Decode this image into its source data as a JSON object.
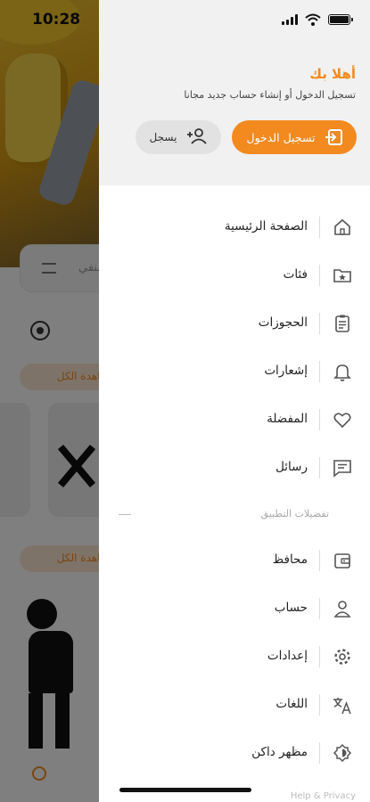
{
  "status_bar": {
    "time": "10:28"
  },
  "background": {
    "search_placeholder": "منفي",
    "view_all_1": "مشاهدة الكل",
    "view_all_2": "مشاهدة الكل"
  },
  "drawer": {
    "greeting": "أهلا بك",
    "subtitle": "تسجيل الدخول أو إنشاء حساب جديد مجانا",
    "login_button": "تسجيل الدخول",
    "register_button": "يسجل",
    "main_items": [
      {
        "label": "الصفحة الرئيسية",
        "icon": "home-icon"
      },
      {
        "label": "فئات",
        "icon": "folder-star-icon"
      },
      {
        "label": "الحجوزات",
        "icon": "clipboard-icon"
      },
      {
        "label": "إشعارات",
        "icon": "bell-icon"
      },
      {
        "label": "المفضلة",
        "icon": "heart-icon"
      },
      {
        "label": "رسائل",
        "icon": "chat-icon"
      }
    ],
    "section_title": "تفضيلات التطبيق",
    "pref_items": [
      {
        "label": "محافظ",
        "icon": "wallet-icon"
      },
      {
        "label": "حساب",
        "icon": "user-icon"
      },
      {
        "label": "إعدادات",
        "icon": "gear-icon"
      },
      {
        "label": "اللغات",
        "icon": "translate-icon"
      },
      {
        "label": "مظهر داكن",
        "icon": "dark-mode-icon"
      }
    ],
    "footer": "Help & Privacy"
  },
  "colors": {
    "accent": "#f28a20",
    "header_bg": "#f1f1f1",
    "text": "#222222"
  }
}
